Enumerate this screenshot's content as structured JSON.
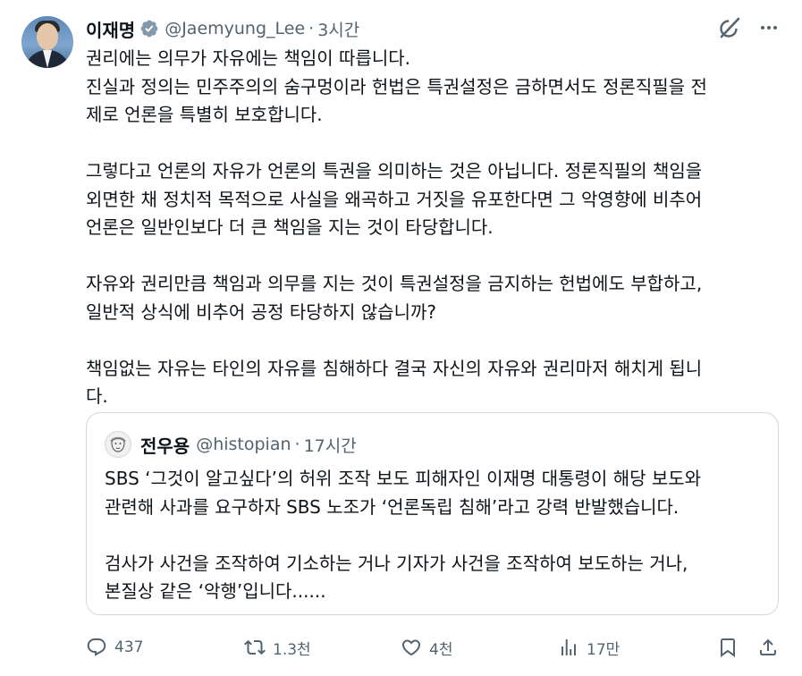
{
  "author": {
    "name": "이재명",
    "handle": "@Jaemyung_Lee",
    "separator": "·",
    "time": "3시간"
  },
  "tweet": {
    "paragraphs": [
      [
        "권리에는 의무가 자유에는 책임이 따릅니다.",
        "진실과 정의는 민주주의의 숨구멍이라 헌법은 특권설정은 금하면서도 정론직필을 전",
        "제로 언론을  특별히 보호합니다."
      ],
      [
        "그렇다고 언론의 자유가 언론의 특권을 의미하는 것은 아닙니다. 정론직필의 책임을",
        "외면한 채 정치적 목적으로 사실을 왜곡하고 거짓을 유포한다면 그 악영향에 비추어",
        "언론은 일반인보다 더 큰 책임을 지는 것이 타당합니다."
      ],
      [
        "자유와 권리만큼 책임과 의무를 지는 것이 특권설정을 금지하는 헌법에도 부합하고,",
        "일반적 상식에 비추어 공정 타당하지 않습니까?"
      ],
      [
        "책임없는 자유는 타인의 자유를 침해하다 결국 자신의 자유와 권리마저 해치게 됩니",
        "다."
      ]
    ]
  },
  "quote": {
    "name": "전우용",
    "handle": "@histopian",
    "separator": "·",
    "time": "17시간",
    "paragraphs": [
      [
        "SBS ‘그것이 알고싶다’의 허위 조작 보도 피해자인 이재명 대통령이 해당 보도와",
        "관련해 사과를 요구하자 SBS 노조가 ‘언론독립 침해’라고 강력 반발했습니다."
      ],
      [
        "검사가 사건을 조작하여 기소하는 거나 기자가 사건을 조작하여 보도하는 거나,",
        "본질상 같은 ‘악행’입니다......"
      ]
    ]
  },
  "actions": {
    "replies": "437",
    "reposts": "1.3천",
    "likes": "4천",
    "views": "17만"
  },
  "icons": {
    "verified": "verified-badge-icon",
    "grok": "grok-icon",
    "more": "more-icon",
    "reply": "reply-icon",
    "repost": "repost-icon",
    "like": "like-icon",
    "views": "views-icon",
    "bookmark": "bookmark-icon",
    "share": "share-icon"
  },
  "colors": {
    "text": "#0f1419",
    "secondary": "#536471",
    "border": "#cfd9de",
    "verified": "#829aab"
  }
}
